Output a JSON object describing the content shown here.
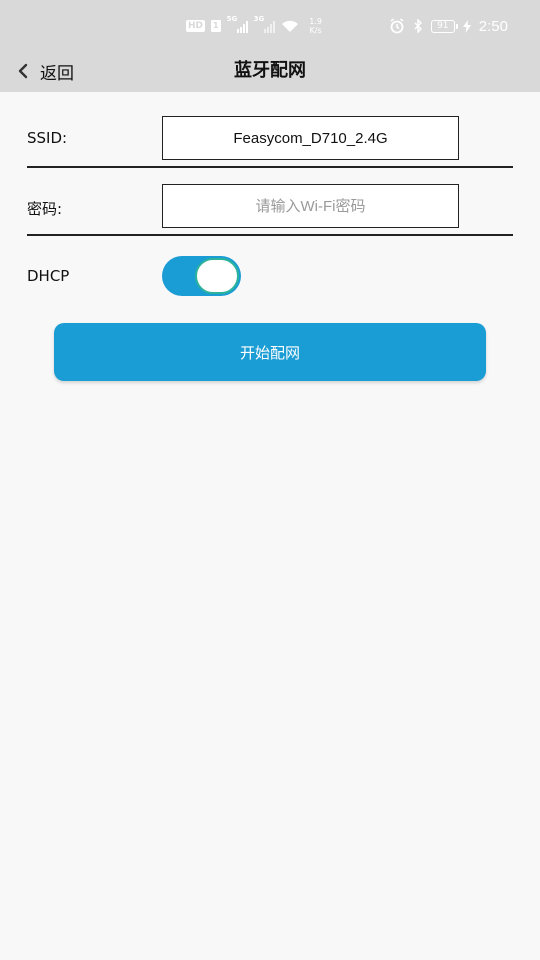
{
  "status_bar": {
    "hd_badge": "HD",
    "sim_badge": "1",
    "sim1_tag": "5G",
    "sim2_tag": "3G",
    "speed_value": "1.9",
    "speed_unit": "K/s",
    "battery": "91",
    "time": "2:50"
  },
  "header": {
    "back_label": "返回",
    "title": "蓝牙配网"
  },
  "form": {
    "ssid_label": "SSID:",
    "ssid_value": "Feasycom_D710_2.4G",
    "password_label": "密码:",
    "password_placeholder": "请输入Wi-Fi密码",
    "password_value": "",
    "dhcp_label": "DHCP",
    "dhcp_enabled": true
  },
  "actions": {
    "start_label": "开始配网"
  },
  "colors": {
    "accent": "#1a9cd4",
    "header_bg": "#d9d9d9",
    "page_bg": "#f8f8f8",
    "toggle_knob_border": "#2db39b"
  }
}
